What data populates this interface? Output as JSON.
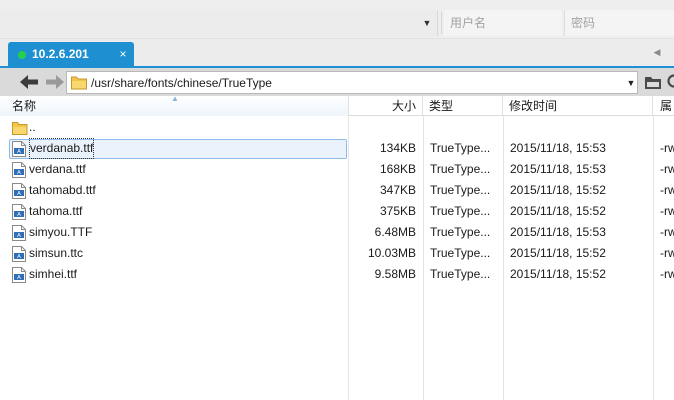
{
  "connection": {
    "host_value": "",
    "username_placeholder": "用户名",
    "password_placeholder": "密码"
  },
  "tabs": [
    {
      "label": "10.2.6.201",
      "close": "×",
      "status_color": "#26d04a"
    }
  ],
  "toolbar": {
    "path": "/usr/share/fonts/chinese/TrueType"
  },
  "columns": {
    "name": "名称",
    "size": "大小",
    "type": "类型",
    "mtime": "修改时间",
    "attr": "属性"
  },
  "parent_dir": {
    "name": ".."
  },
  "files": [
    {
      "name": "verdanab.ttf",
      "size": "134KB",
      "type": "TrueType...",
      "mtime": "2015/11/18, 15:53",
      "attr": "-rw"
    },
    {
      "name": "verdana.ttf",
      "size": "168KB",
      "type": "TrueType...",
      "mtime": "2015/11/18, 15:53",
      "attr": "-rw"
    },
    {
      "name": "tahomabd.ttf",
      "size": "347KB",
      "type": "TrueType...",
      "mtime": "2015/11/18, 15:52",
      "attr": "-rw"
    },
    {
      "name": "tahoma.ttf",
      "size": "375KB",
      "type": "TrueType...",
      "mtime": "2015/11/18, 15:52",
      "attr": "-rw"
    },
    {
      "name": "simyou.TTF",
      "size": "6.48MB",
      "type": "TrueType...",
      "mtime": "2015/11/18, 15:53",
      "attr": "-rw"
    },
    {
      "name": "simsun.ttc",
      "size": "10.03MB",
      "type": "TrueType...",
      "mtime": "2015/11/18, 15:52",
      "attr": "-rw"
    },
    {
      "name": "simhei.ttf",
      "size": "9.58MB",
      "type": "TrueType...",
      "mtime": "2015/11/18, 15:52",
      "attr": "-rw"
    }
  ],
  "icons": {
    "back": "arrow-left-icon",
    "forward": "arrow-right-icon",
    "folder": "folder-icon",
    "file": "font-file-icon",
    "open_folder": "folder-open-icon",
    "search": "search-icon"
  },
  "colors": {
    "accent": "#1e8fd0",
    "selection_bg": "#eaf3fb",
    "selection_border": "#8fbbe6"
  }
}
